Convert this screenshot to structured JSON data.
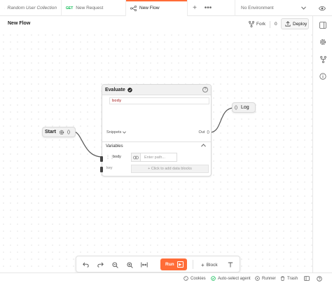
{
  "tabs": [
    {
      "label": "Random User Collection",
      "active": false
    },
    {
      "method": "GET",
      "label": "New Request",
      "active": false
    },
    {
      "label": "New Flow",
      "active": true
    }
  ],
  "environment": {
    "selected": "No Environment"
  },
  "header": {
    "title": "New Flow",
    "fork_label": "Fork",
    "fork_count": "0",
    "deploy_label": "Deploy"
  },
  "canvas": {
    "start_node": {
      "label": "Start",
      "port_label": "()"
    },
    "evaluate_node": {
      "title": "Evaluate",
      "code": "body",
      "snippets_label": "Snippets",
      "out_label": "Out",
      "out_port": "()",
      "variables_label": "Variables",
      "variable": {
        "name": "body",
        "path_placeholder": "Enter path..."
      },
      "key_label": "key",
      "add_block_label": "+ Click to add data blocks"
    },
    "log_node": {
      "port_label": "()",
      "label": "Log"
    }
  },
  "toolbar": {
    "run_label": "Run",
    "block_label": "Block"
  },
  "statusbar": {
    "cookies": "Cookies",
    "agent": "Auto-select agent",
    "runner": "Runner",
    "trash": "Trash"
  },
  "colors": {
    "accent": "#ff6c37",
    "method_get": "#0cbb52"
  }
}
